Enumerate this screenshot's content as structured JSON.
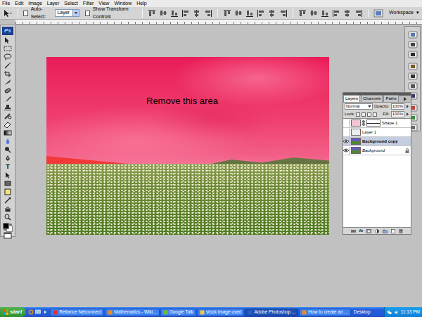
{
  "menu": [
    "File",
    "Edit",
    "Image",
    "Layer",
    "Select",
    "Filter",
    "View",
    "Window",
    "Help"
  ],
  "options_bar": {
    "auto_select_label": "Auto-Select:",
    "auto_select_checked": false,
    "auto_select_target": "Layer",
    "transform_label": "Show Transform Controls",
    "transform_checked": false,
    "workspace": "Workspace",
    "workspace_arrow": "▾"
  },
  "toolbox": {
    "logo": "Ps",
    "type_tool": "T"
  },
  "canvas": {
    "annotation": "Remove this area"
  },
  "layers_panel": {
    "tabs": [
      {
        "label": "Layers",
        "selected": true
      },
      {
        "label": "Channels",
        "selected": false
      },
      {
        "label": "Paths",
        "selected": false
      }
    ],
    "blend_mode": "Normal",
    "opacity_label": "Opacity:",
    "opacity": "100%",
    "lock_label": "Lock:",
    "fill_label": "Fill:",
    "fill": "100%",
    "layers": [
      {
        "name": "Shape 1",
        "kind": "shape",
        "visible": false,
        "selected": false,
        "locked": false
      },
      {
        "name": "Layer 1",
        "kind": "layer",
        "visible": false,
        "selected": false,
        "locked": false
      },
      {
        "name": "Background copy",
        "kind": "image",
        "visible": true,
        "selected": true,
        "locked": false
      },
      {
        "name": "Background",
        "kind": "image",
        "visible": true,
        "selected": false,
        "locked": true
      }
    ],
    "footer_fx": "fx"
  },
  "taskbar": {
    "start": "start",
    "buttons": [
      {
        "label": "Reliance Netconnect",
        "selected": false
      },
      {
        "label": "Mathematics - Wiki...",
        "selected": false
      },
      {
        "label": "Google Talk",
        "selected": false
      },
      {
        "label": "stock image used",
        "selected": false
      },
      {
        "label": "Adobe Photoshop ...",
        "selected": true
      },
      {
        "label": "How to create an ...",
        "selected": false
      }
    ],
    "desktop": "Desktop",
    "clock": "11:13 PM"
  }
}
